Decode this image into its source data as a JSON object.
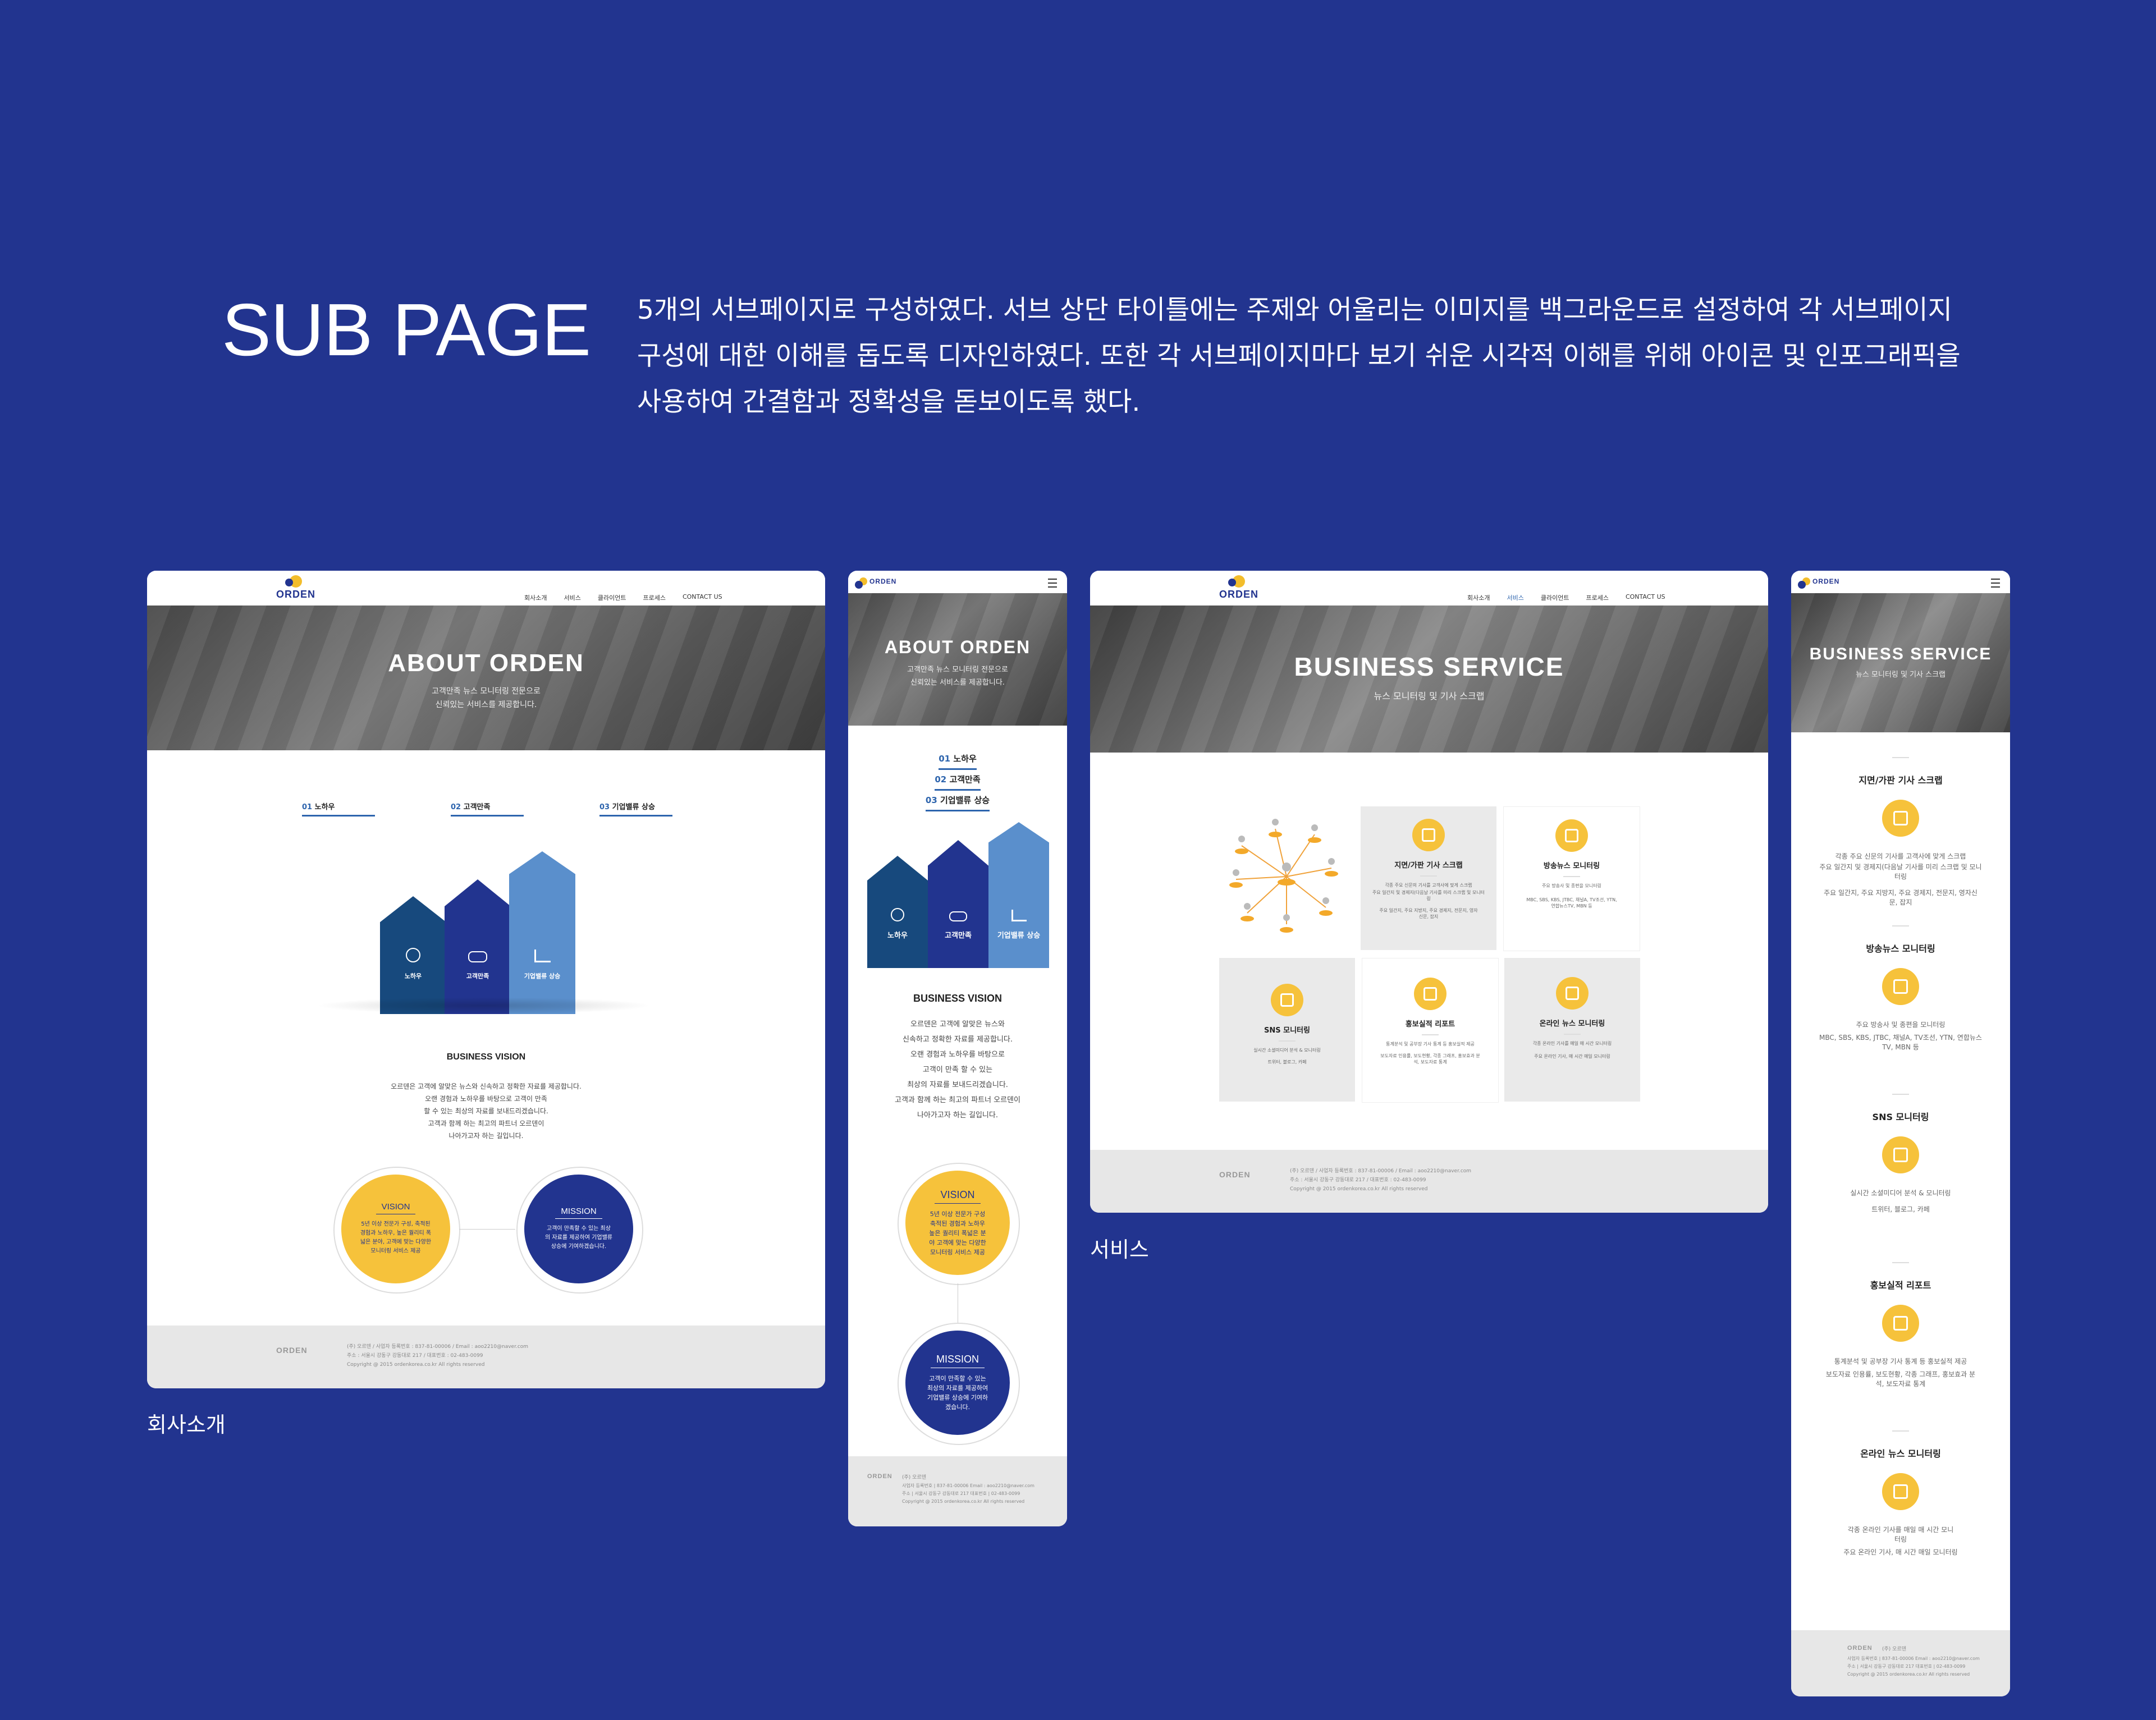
{
  "page": {
    "title": "SUB PAGE",
    "description": "5개의 서브페이지로 구성하였다. 서브 상단 타이틀에는 주제와 어울리는 이미지를 백그라운드로 설정하여 각 서브페이지 구성에 대한 이해를 돕도록 디자인하였다. 또한 각 서브페이지마다 보기 쉬운 시각적 이해를 위해 아이콘 및 인포그래픽을 사용하여 간결함과 정확성을 돋보이도록 했다.",
    "caption_about": "회사소개",
    "caption_service": "서비스"
  },
  "brand": {
    "logo": "ORDEN",
    "accent": "#f3bd2b",
    "navy": "#22348f",
    "blue": "#2d64ad"
  },
  "nav": {
    "items": [
      "회사소개",
      "서비스",
      "클라이언트",
      "프로세스",
      "CONTACT US"
    ]
  },
  "about": {
    "hero_title": "ABOUT ORDEN",
    "hero_sub1": "고객만족 뉴스 모니터링 전문으로",
    "hero_sub2": "신뢰있는 서비스를 제공합니다.",
    "tabs": [
      {
        "num": "01",
        "label": "노하우"
      },
      {
        "num": "02",
        "label": "고객만족"
      },
      {
        "num": "03",
        "label": "기업밸류 상승"
      }
    ],
    "chevrons": [
      "노하우",
      "고객만족",
      "기업밸류 상승"
    ],
    "vision_title": "BUSINESS VISION",
    "vision_lines": [
      "오르덴은 고객에 알맞은 뉴스와 신속하고 정확한 자료를 제공합니다.",
      "오랜 경험과 노하우를 바탕으로 고객이 만족",
      "할 수 있는 최상의 자료를 보내드리겠습니다.",
      "고객과 함께 하는 최고의 파트너 오르덴이",
      "나아가고자 하는 길입니다."
    ],
    "vision_label": "VISION",
    "vision_text": "5년 이상 전문가 구성, 축적된 경험과 노하우, 높은 퀄리티 폭넓은 분야, 고객에 맞는 다양한 모니터링 서비스 제공",
    "mission_label": "MISSION",
    "mission_text": "고객이 만족할 수 있는 최상의 자료를 제공하여 기업밸류 상승에 기여하겠습니다.",
    "footer_line1": "(주) 오르덴 / 사업자 등록번호 : 837-81-00006 / Email : aoo2210@naver.com",
    "footer_line2": "주소 : 서울시 강동구 강동대로 217 / 대표번호 : 02-483-0099",
    "footer_line3": "Copyright @ 2015 ordenkorea.co.kr All rights reserved"
  },
  "about_mobile": {
    "hero_title": "ABOUT ORDEN",
    "hero_sub1": "고객만족 뉴스 모니터링 전문으로",
    "hero_sub2": "신뢰있는 서비스를 제공합니다.",
    "vision_lines": [
      "오르덴은 고객에 알맞은 뉴스와",
      "신속하고 정확한 자료를 제공합니다.",
      "오랜 경험과 노하우를 바탕으로",
      "고객이 만족 할 수 있는",
      "최상의 자료를 보내드리겠습니다.",
      "고객과 함께 하는 최고의 파트너 오르덴이",
      "나아가고자 하는 길입니다."
    ],
    "vision_text": "5년 이상 전문가 구성 축적된 경험과 노하우 높은 퀄리티 폭넓은 분야 고객에 맞는 다양한 모니터링 서비스 제공",
    "mission_text": "고객이 만족할 수 있는 최상의 자료를 제공하여 기업밸류 상승에 기여하겠습니다.",
    "footer_company": "(주) 오르덴",
    "footer_line1": "사업자 등록번호 | 837-81-00006 Email : aoo2210@naver.com",
    "footer_line2": "주소 | 서울시 강동구 강동대로 217 대표번호 | 02-483-0099",
    "footer_line3": "Copyright @ 2015 ordenkorea.co.kr All rights reserved"
  },
  "service": {
    "hero_title": "BUSINESS SERVICE",
    "hero_sub": "뉴스 모니터링 및 기사 스크랩",
    "items": [
      {
        "title": "지면/가판 기사 스크랩",
        "desc1": "각종 주요 신문의 기사를 고객사에 맞게 스크랩",
        "desc2": "주요 일간지 및 경제지(다음날 기사를 미리 스크랩 및 모니터링",
        "desc3": "주요 일간지, 주요 지방지, 주요 경제지, 전문지, 영자신문, 잡지"
      },
      {
        "title": "방송뉴스 모니터링",
        "desc1": "주요 방송사 및 종편을 모니터링",
        "desc2": "MBC, SBS, KBS, JTBC, 채널A, TV조선, YTN, 연합뉴스TV, MBN 등",
        "desc3": ""
      },
      {
        "title": "SNS 모니터링",
        "desc1": "실시간 소셜미디어 분석 & 모니터링",
        "desc2": "트위터, 블로그, 카페",
        "desc3": ""
      },
      {
        "title": "홍보실적 리포트",
        "desc1": "통계분석 및 공부장 기사 통계 등 홍보실적 제공",
        "desc2": "보도자료 인용률, 보도현황, 각종 그래프, 홍보효과 분석, 보도자료 통계",
        "desc3": ""
      },
      {
        "title": "온라인 뉴스 모니터링",
        "desc1": "각종 온라인 기사를 매일 매 시간 모니터링",
        "desc2": "주요 온라인 기사, 매 시간 매일 모니터링",
        "desc3": ""
      }
    ],
    "footer_line1": "(주) 오르덴 / 사업자 등록번호 : 837-81-00006 / Email : aoo2210@naver.com",
    "footer_line2": "주소 : 서울시 강동구 강동대로 217 / 대표번호 : 02-483-0099",
    "footer_line3": "Copyright @ 2015 ordenkorea.co.kr All rights reserved"
  },
  "service_mobile": {
    "hero_title": "BUSINESS SERVICE",
    "hero_sub": "뉴스 모니터링 및 기사 스크랩",
    "items": [
      {
        "title": "지면/가판 기사 스크랩",
        "desc1": "각종 주요 신문의 기사를 고객사에 맞게 스크랩",
        "desc2": "주요 일간지 및 경제지(다음날 기사를 미리 스크랩 및 모니터링",
        "desc3": "주요 일간지, 주요 지방지, 주요 경제지, 전문지, 영자신문, 잡지"
      },
      {
        "title": "방송뉴스 모니터링",
        "desc1": "주요 방송사 및 종편을 모니터링",
        "desc2": "MBC, SBS, KBS, JTBC, 채널A, TV조선, YTN, 연합뉴스TV, MBN 등",
        "desc3": ""
      },
      {
        "title": "SNS 모니터링",
        "desc1": "실시간 소셜미디어 분석 & 모니터링",
        "desc2": "트위터, 블로그, 카페",
        "desc3": ""
      },
      {
        "title": "홍보실적 리포트",
        "desc1": "통계분석 및 공부장 기사 통계 등 홍보실적 제공",
        "desc2": "보도자료 인용률, 보도현황, 각종 그래프, 홍보효과 분석, 보도자료 통계",
        "desc3": ""
      },
      {
        "title": "온라인 뉴스 모니터링",
        "desc1": "각종 온라인 기사를 매일 매 시간 모니터링",
        "desc2": "주요 온라인 기사, 매 시간 매일 모니터링",
        "desc3": ""
      }
    ],
    "footer_company": "(주) 오르덴",
    "footer_line1": "사업자 등록번호 | 837-81-00006 Email : aoo2210@naver.com",
    "footer_line2": "주소 | 서울시 강동구 강동대로 217 대표번호 | 02-483-0099",
    "footer_line3": "Copyright @ 2015 ordenkorea.co.kr All rights reserved"
  }
}
